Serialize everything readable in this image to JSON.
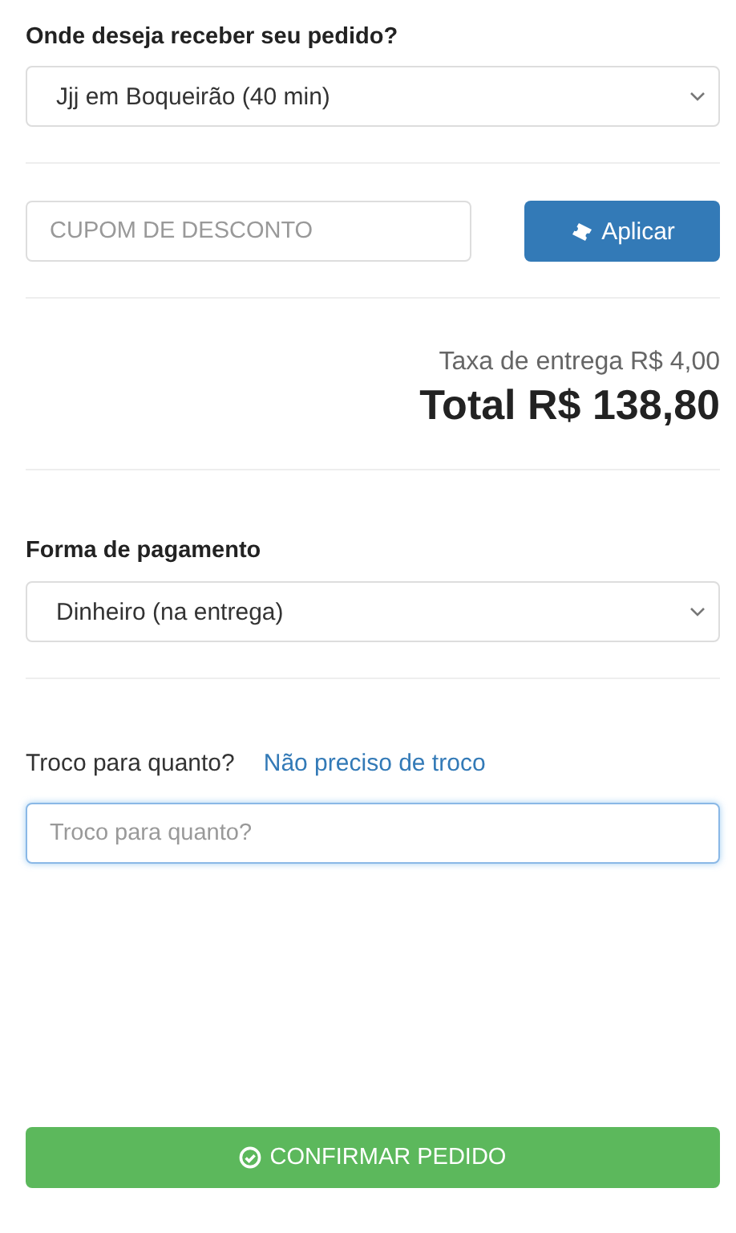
{
  "delivery": {
    "label": "Onde deseja receber seu pedido?",
    "value": "Jjj em Boqueirão (40 min)"
  },
  "coupon": {
    "placeholder": "CUPOM DE DESCONTO",
    "button": "Aplicar"
  },
  "summary": {
    "fee": "Taxa de entrega R$ 4,00",
    "total": "Total R$ 138,80"
  },
  "payment": {
    "label": "Forma de pagamento",
    "value": "Dinheiro (na entrega)"
  },
  "change": {
    "label": "Troco para quanto?",
    "link": "Não preciso de troco",
    "placeholder": "Troco para quanto?",
    "focused": true
  },
  "confirm": {
    "label": "CONFIRMAR PEDIDO"
  }
}
